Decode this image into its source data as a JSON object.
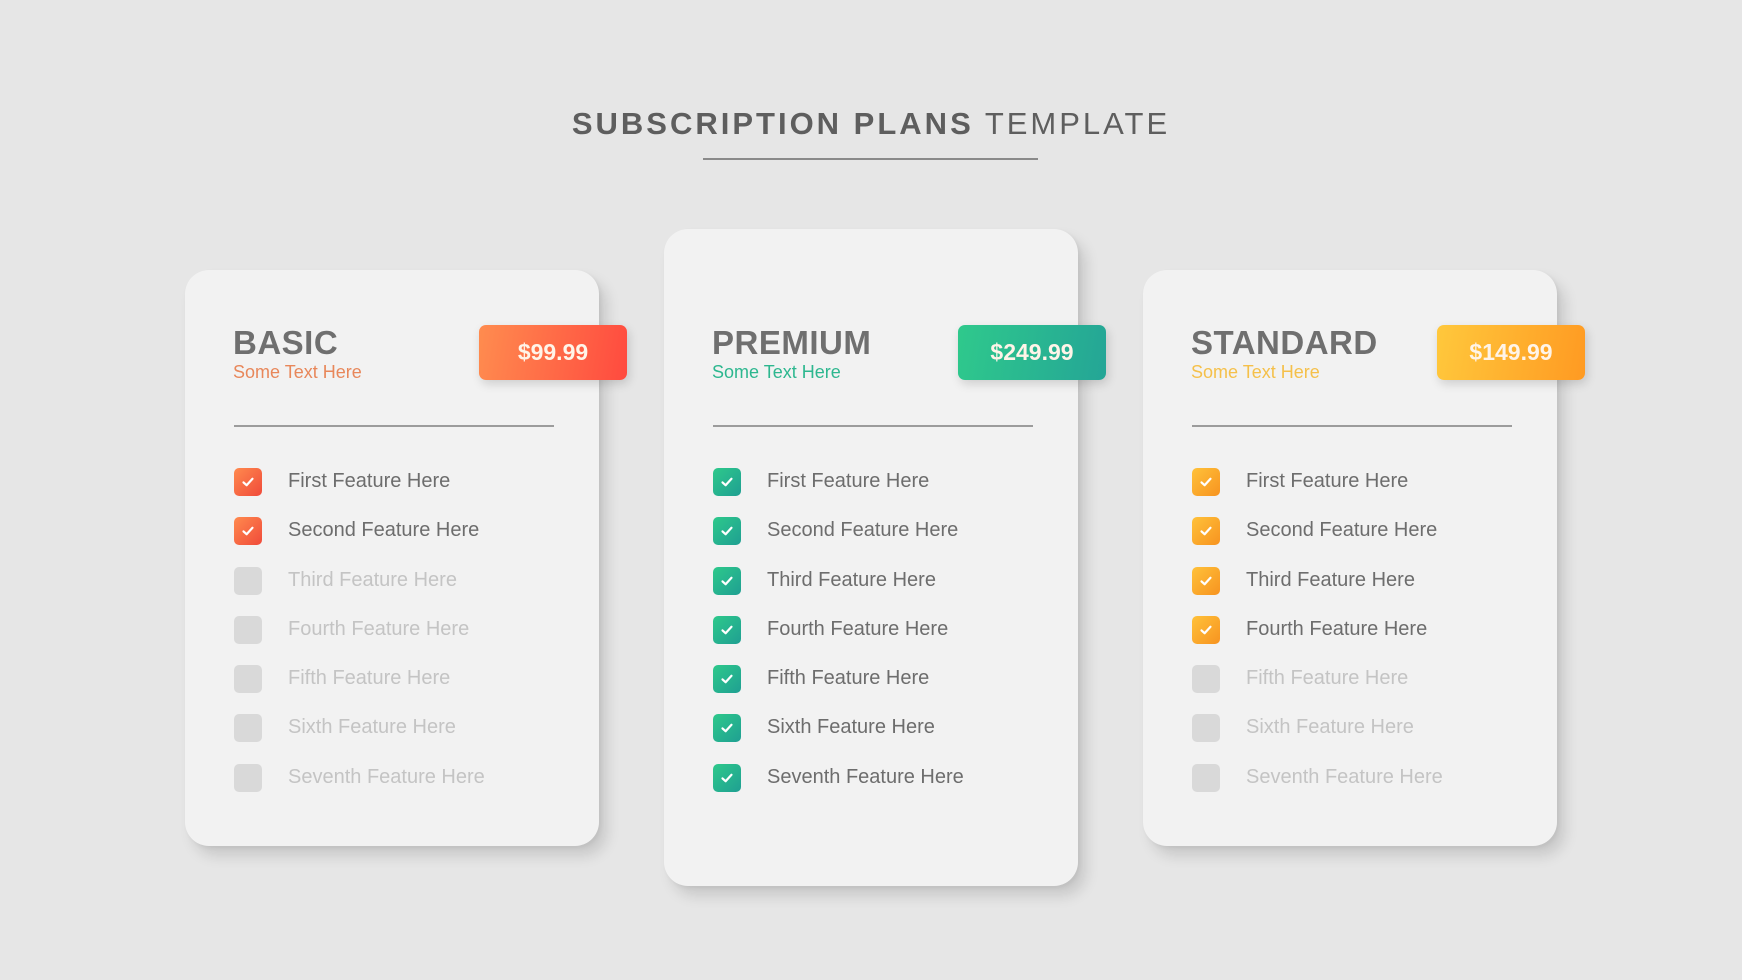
{
  "header": {
    "title_bold": "SUBSCRIPTION PLANS",
    "title_light": "TEMPLATE"
  },
  "icons": {
    "check": "check-icon"
  },
  "plans": [
    {
      "name": "BASIC",
      "subtitle": "Some Text Here",
      "price": "$99.99",
      "accent": "#ff6a45",
      "features": [
        {
          "label": "First Feature Here",
          "included": true
        },
        {
          "label": "Second Feature Here",
          "included": true
        },
        {
          "label": "Third Feature Here",
          "included": false
        },
        {
          "label": "Fourth Feature Here",
          "included": false
        },
        {
          "label": "Fifth Feature Here",
          "included": false
        },
        {
          "label": "Sixth Feature Here",
          "included": false
        },
        {
          "label": "Seventh Feature Here",
          "included": false
        }
      ]
    },
    {
      "name": "PREMIUM",
      "subtitle": "Some Text Here",
      "price": "$249.99",
      "accent": "#2ab891",
      "features": [
        {
          "label": "First Feature Here",
          "included": true
        },
        {
          "label": "Second Feature Here",
          "included": true
        },
        {
          "label": "Third Feature Here",
          "included": true
        },
        {
          "label": "Fourth Feature Here",
          "included": true
        },
        {
          "label": "Fifth Feature Here",
          "included": true
        },
        {
          "label": "Sixth Feature Here",
          "included": true
        },
        {
          "label": "Seventh Feature Here",
          "included": true
        }
      ]
    },
    {
      "name": "STANDARD",
      "subtitle": "Some Text Here",
      "price": "$149.99",
      "accent": "#ffb130",
      "features": [
        {
          "label": "First Feature Here",
          "included": true
        },
        {
          "label": "Second Feature Here",
          "included": true
        },
        {
          "label": "Third Feature Here",
          "included": true
        },
        {
          "label": "Fourth Feature Here",
          "included": true
        },
        {
          "label": "Fifth Feature Here",
          "included": false
        },
        {
          "label": "Sixth Feature Here",
          "included": false
        },
        {
          "label": "Seventh Feature Here",
          "included": false
        }
      ]
    }
  ]
}
